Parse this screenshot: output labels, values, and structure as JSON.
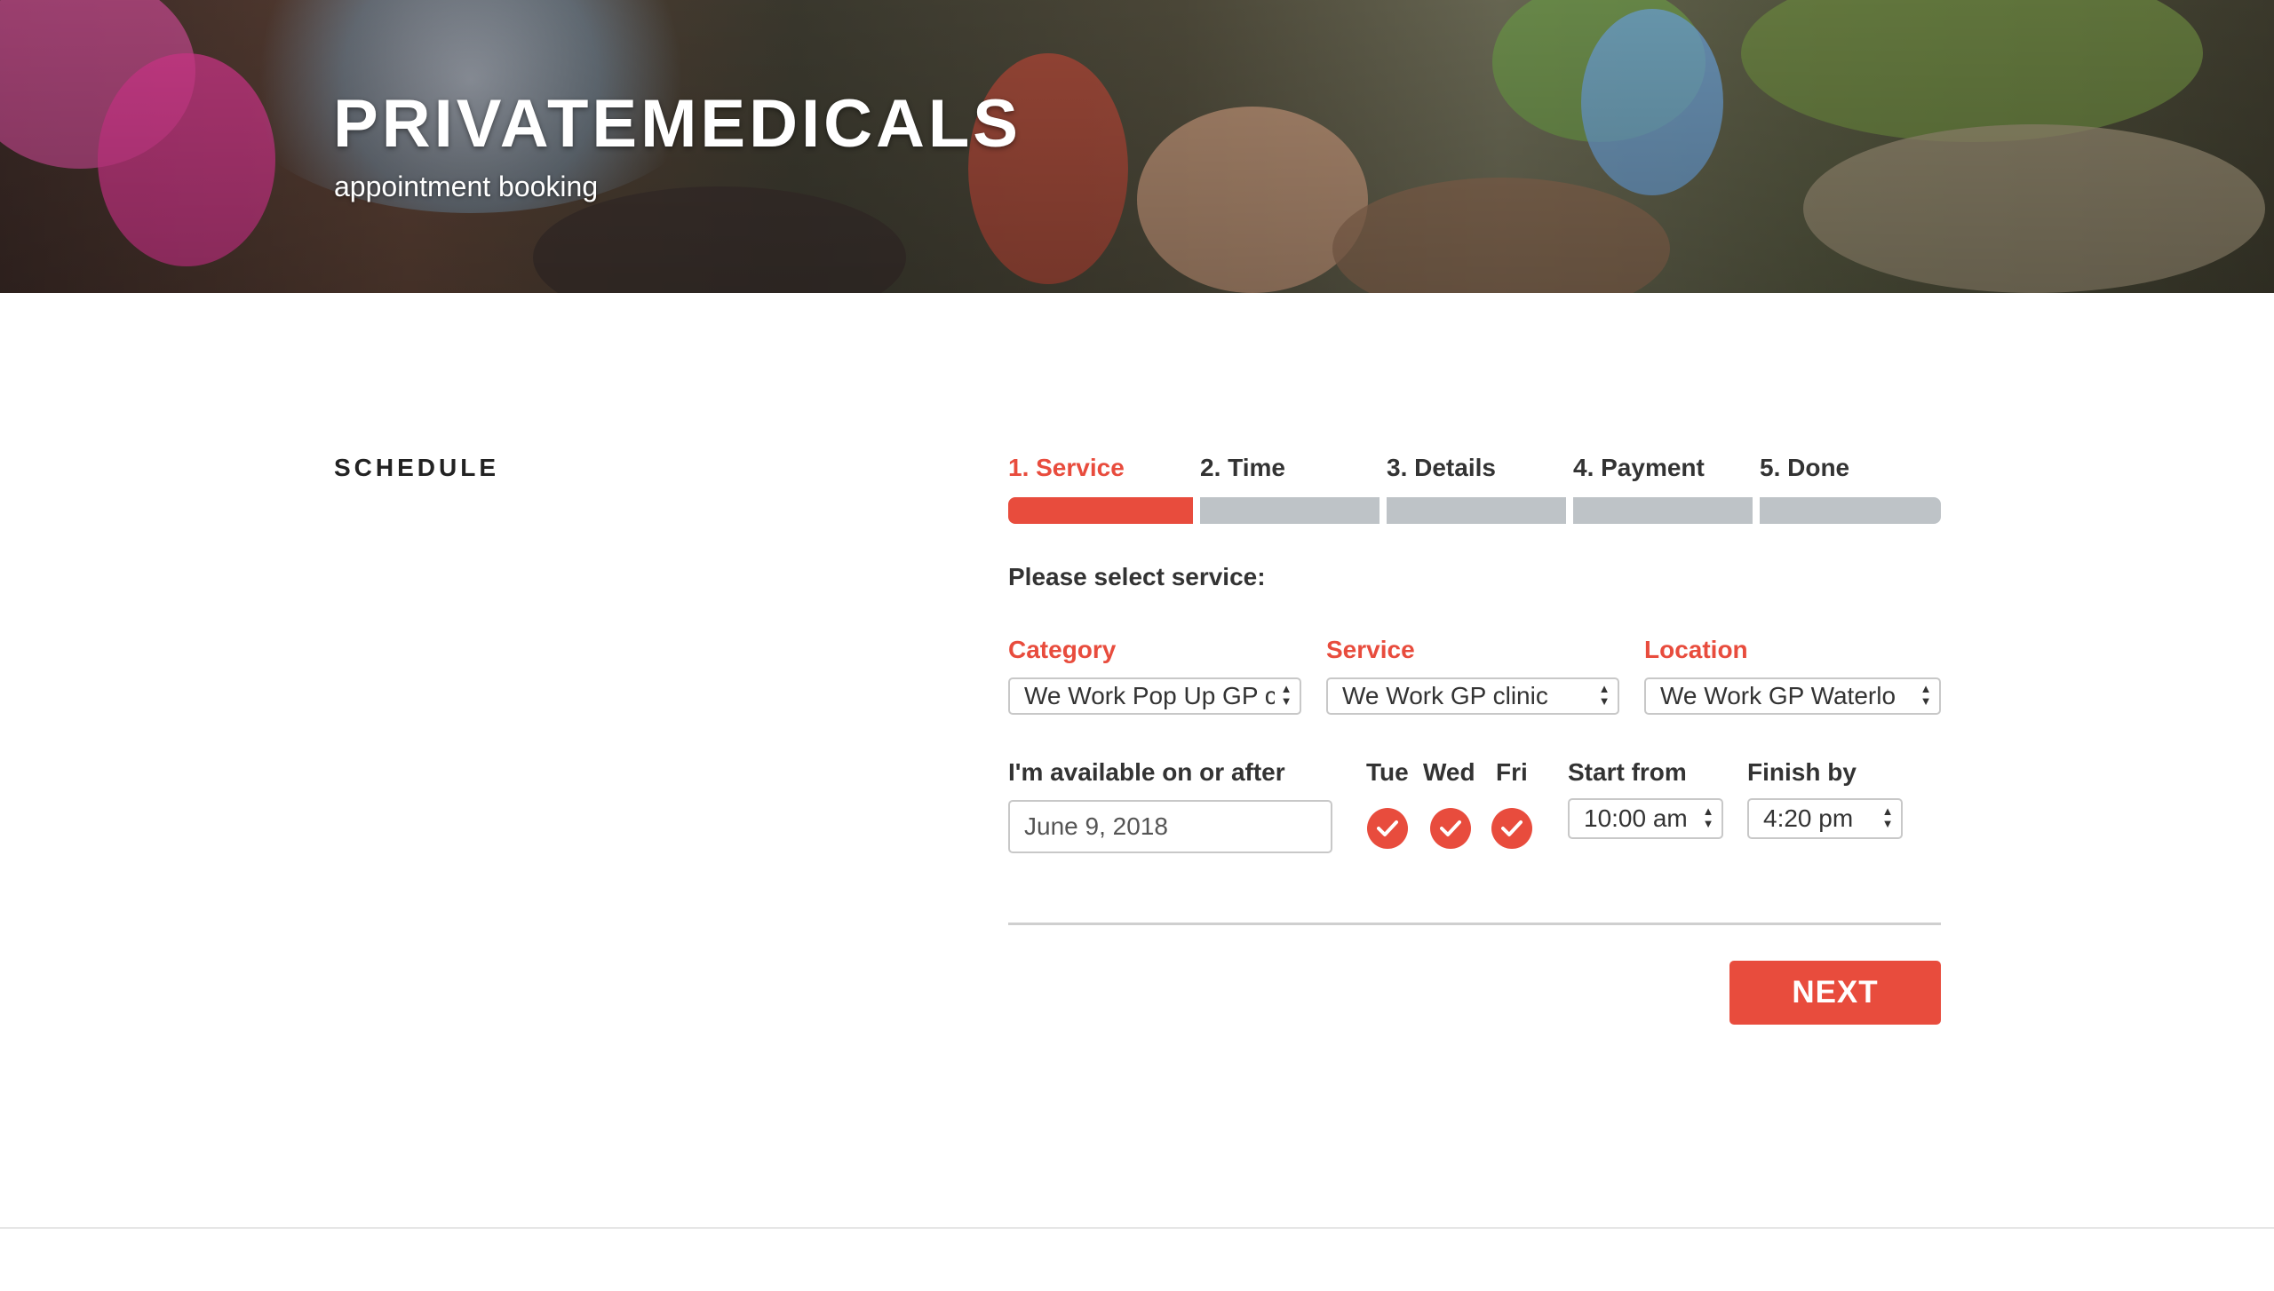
{
  "header": {
    "site_title": "PRIVATEMEDICALS",
    "site_description": "appointment booking"
  },
  "page": {
    "section_title": "SCHEDULE"
  },
  "booking": {
    "steps": [
      {
        "label": "1. Service",
        "active": true
      },
      {
        "label": "2. Time",
        "active": false
      },
      {
        "label": "3. Details",
        "active": false
      },
      {
        "label": "4. Payment",
        "active": false
      },
      {
        "label": "5. Done",
        "active": false
      }
    ],
    "prompt": "Please select service:",
    "category": {
      "label": "Category",
      "value": "We Work Pop Up GP c"
    },
    "service": {
      "label": "Service",
      "value": "We Work GP clinic"
    },
    "location": {
      "label": "Location",
      "value": "We Work GP Waterlo"
    },
    "availability": {
      "label": "I'm available on or after",
      "date": "June 9, 2018"
    },
    "days": [
      {
        "label": "Tue",
        "checked": true
      },
      {
        "label": "Wed",
        "checked": true
      },
      {
        "label": "Fri",
        "checked": true
      }
    ],
    "start_from": {
      "label": "Start from",
      "value": "10:00 am"
    },
    "finish_by": {
      "label": "Finish by",
      "value": "4:20 pm"
    },
    "next_button": "NEXT"
  },
  "colors": {
    "accent": "#e84c3d",
    "inactive_bar": "#bec3c7",
    "text": "#333333"
  },
  "icons": {
    "day_check": "check-icon",
    "select_arrows": "updown-arrows-icon"
  }
}
